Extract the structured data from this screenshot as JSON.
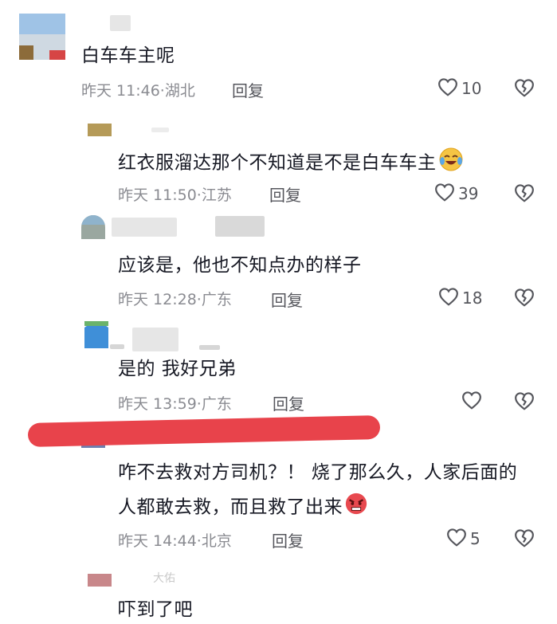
{
  "comments": [
    {
      "text": "白车车主呢",
      "time": "昨天 11:46",
      "location": "湖北",
      "reply": "回复",
      "likes": "10"
    },
    {
      "text": "红衣服溜达那个不知道是不是白车车主",
      "time": "昨天 11:50",
      "location": "江苏",
      "reply": "回复",
      "likes": "39",
      "emoji": "laughing-crying-emoji"
    },
    {
      "text": "应该是，他也不知点办的样子",
      "time": "昨天 12:28",
      "location": "广东",
      "reply": "回复",
      "likes": "18"
    },
    {
      "text": "是的 我好兄弟",
      "time": "昨天 13:59",
      "location": "广东",
      "reply": "回复",
      "likes": ""
    },
    {
      "line1": "咋不去救对方司机？！ 烧了那么久，人家后面的",
      "line2": "人都敢去救，而且救了出来",
      "time": "昨天 14:44",
      "location": "北京",
      "reply": "回复",
      "likes": "5",
      "emoji": "angry-face-emoji",
      "name_hint": "大佑"
    },
    {
      "text": "吓到了吧",
      "name_hint": "大佑"
    }
  ],
  "meta_separator": "·",
  "icons": {
    "like": "heart-outline-icon",
    "dislike": "broken-heart-icon"
  },
  "colors": {
    "text": "#161823",
    "meta": "#8a8b91",
    "redline": "#e8434b"
  }
}
